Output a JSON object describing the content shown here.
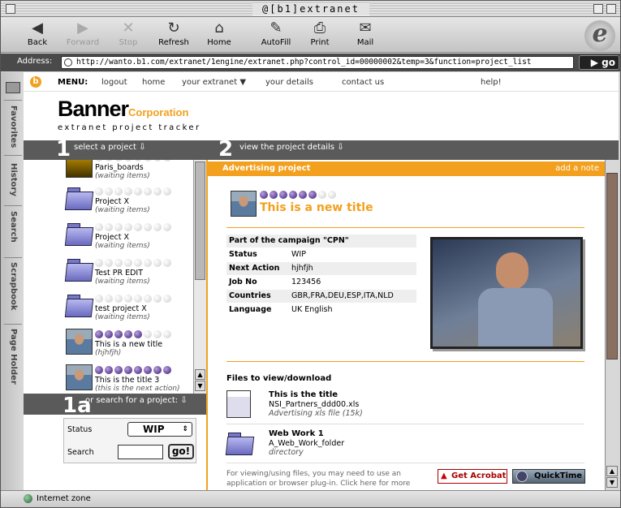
{
  "window": {
    "title": "@[b1]extranet"
  },
  "toolbar": {
    "back": "Back",
    "forward": "Forward",
    "stop": "Stop",
    "refresh": "Refresh",
    "home": "Home",
    "autofill": "AutoFill",
    "print": "Print",
    "mail": "Mail"
  },
  "address": {
    "label": "Address:",
    "url": "http://wanto.b1.com/extranet/1engine/extranet.php?control_id=00000002&temp=3&function=project_list",
    "go": "go"
  },
  "sidetabs": [
    "Favorites",
    "History",
    "Search",
    "Scrapbook",
    "Page Holder"
  ],
  "menu": {
    "label": "MENU:",
    "logout": "logout",
    "home": "home",
    "your_extranet": "your extranet",
    "your_details": "your details",
    "contact_us": "contact us",
    "help": "help!"
  },
  "brand": {
    "name": "Banner",
    "corp": "Corporation",
    "subtitle": "extranet project tracker"
  },
  "steps": {
    "one_num": "1",
    "one_text": "select  a project",
    "two_num": "2",
    "two_text": "view the project details",
    "onea_num": "1a",
    "onea_text": "or search for a project:"
  },
  "projects": [
    {
      "name": "Paris_boards",
      "status": "(waiting items)",
      "rating": 0,
      "thumb": "photo-icon"
    },
    {
      "name": "Project X",
      "status": "(waiting items)",
      "rating": 0,
      "thumb": "folder-icon"
    },
    {
      "name": "Project X",
      "status": "(waiting items)",
      "rating": 0,
      "thumb": "folder-icon"
    },
    {
      "name": "Test PR EDIT",
      "status": "(waiting items)",
      "rating": 0,
      "thumb": "folder-icon"
    },
    {
      "name": "test project X",
      "status": "(waiting items)",
      "rating": 0,
      "thumb": "folder-icon"
    },
    {
      "name": "This is a new title",
      "status": "(hjhfjh)",
      "rating": 5,
      "thumb": "portrait-icon"
    },
    {
      "name": "This is the title 3",
      "status": "(this is the next action)",
      "rating": 8,
      "thumb": "portrait-icon"
    }
  ],
  "search": {
    "status_label": "Status",
    "status_value": "WIP",
    "search_label": "Search",
    "search_value": "",
    "go": "go!"
  },
  "detail": {
    "header": "Advertising project",
    "add_note": "add a note",
    "title": "This is a new title",
    "rating": 6,
    "rows": [
      {
        "k": "Part of the campaign \"CPN\"",
        "v": ""
      },
      {
        "k": "Status",
        "v": "WIP"
      },
      {
        "k": "Next Action",
        "v": "hjhfjh"
      },
      {
        "k": "Job No",
        "v": "123456"
      },
      {
        "k": "Countries",
        "v": "GBR,FRA,DEU,ESP,ITA,NLD"
      },
      {
        "k": "Language",
        "v": "UK English"
      }
    ],
    "files_heading": "Files to view/download",
    "files": [
      {
        "title": "This is the title",
        "name": "NSI_Partners_ddd00.xls",
        "desc": "Advertising xls file (15k)",
        "icon": "spreadsheet-icon"
      },
      {
        "title": "Web Work 1",
        "name": "A_Web_Work_folder",
        "desc": "directory",
        "icon": "folder-icon"
      }
    ],
    "footer_note": "For viewing/using files, you may need to use an application or browser plug-in. Click here for more",
    "acrobat": "Get Acrobat",
    "quicktime": "QuickTime"
  },
  "statusbar": {
    "zone": "Internet zone"
  },
  "colors": {
    "accent": "#f2a01e",
    "stepbar": "#5a5a5a",
    "rating_on": "#3a1a70"
  }
}
